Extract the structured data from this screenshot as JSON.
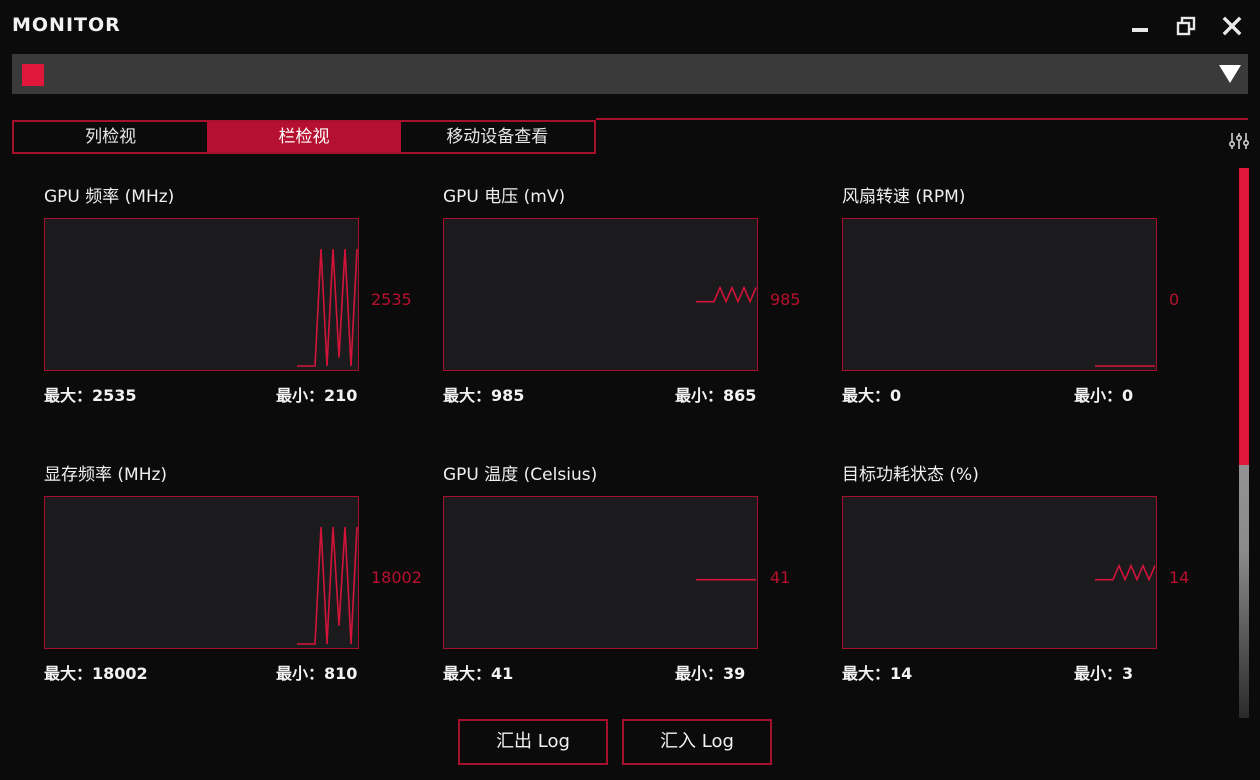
{
  "app": {
    "title": "MONITOR"
  },
  "colors": {
    "accent": "#b5102f",
    "graph_line": "#d3143a",
    "background": "#0b0b0c",
    "graph_bg": "#1b1b1d"
  },
  "device_selector": {
    "selected": ""
  },
  "tabs": [
    {
      "label": "列检视",
      "active": false
    },
    {
      "label": "栏检视",
      "active": true
    },
    {
      "label": "移动设备查看",
      "active": false
    }
  ],
  "scrollbar": {
    "visible_fraction": 0.54
  },
  "metrics": [
    {
      "title": "GPU 频率 (MHz)",
      "current": "2535",
      "max_label": "最大：2535",
      "min_label": "最小：210",
      "samples": [
        210,
        210,
        210,
        2535,
        210,
        2535,
        380,
        2535,
        210,
        2535
      ]
    },
    {
      "title": "GPU 电压 (mV)",
      "current": "985",
      "max_label": "最大：985",
      "min_label": "最小：865",
      "samples": [
        940,
        940,
        940,
        985,
        940,
        985,
        940,
        985,
        940,
        985
      ]
    },
    {
      "title": "风扇转速 (RPM)",
      "current": "0",
      "max_label": "最大：0",
      "min_label": "最小：0",
      "samples": [
        0,
        0,
        0,
        0,
        0,
        0,
        0,
        0,
        0,
        0
      ]
    },
    {
      "title": "显存频率 (MHz)",
      "current": "18002",
      "max_label": "最大：18002",
      "min_label": "最小：810",
      "samples": [
        810,
        810,
        810,
        18002,
        810,
        18002,
        3500,
        18002,
        810,
        18002
      ]
    },
    {
      "title": "GPU 温度 (Celsius)",
      "current": "41",
      "max_label": "最大：41",
      "min_label": "最小：39",
      "samples": [
        41,
        41,
        41,
        41,
        41,
        41,
        41,
        41,
        41,
        41
      ]
    },
    {
      "title": "目标功耗状态 (%)",
      "current": "14",
      "max_label": "最大：14",
      "min_label": "最小：3",
      "samples": [
        3,
        3,
        3,
        14,
        3,
        14,
        3,
        14,
        3,
        14
      ]
    }
  ],
  "buttons": {
    "export": "汇出 Log",
    "import": "汇入 Log"
  }
}
